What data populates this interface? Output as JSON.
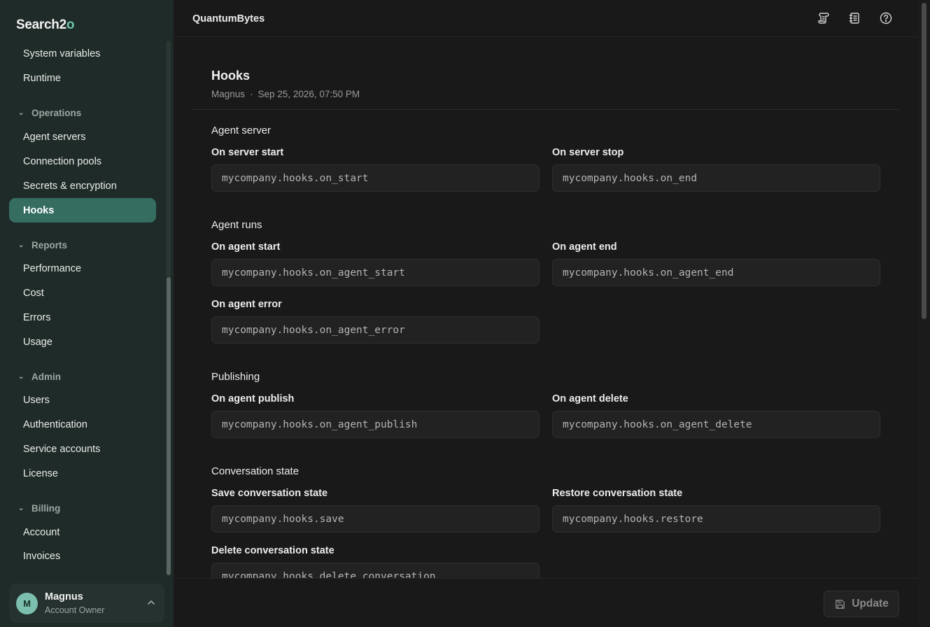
{
  "app": {
    "logo_main": "Search2",
    "logo_accent": "o",
    "org_name": "QuantumBytes"
  },
  "sidebar": {
    "items_top": [
      "System variables",
      "Runtime"
    ],
    "sections": [
      {
        "title": "Operations",
        "items": [
          "Agent servers",
          "Connection pools",
          "Secrets & encryption",
          "Hooks"
        ]
      },
      {
        "title": "Reports",
        "items": [
          "Performance",
          "Cost",
          "Errors",
          "Usage"
        ]
      },
      {
        "title": "Admin",
        "items": [
          "Users",
          "Authentication",
          "Service accounts",
          "License"
        ]
      },
      {
        "title": "Billing",
        "items": [
          "Account",
          "Invoices"
        ]
      }
    ],
    "active_item": "Hooks",
    "user": {
      "initial": "M",
      "name": "Magnus",
      "role": "Account Owner"
    }
  },
  "header": {
    "icons": [
      "scroll-icon",
      "notebook-icon",
      "help-icon"
    ]
  },
  "page": {
    "title": "Hooks",
    "author": "Magnus",
    "separator": "·",
    "timestamp": "Sep 25, 2026, 07:50 PM",
    "groups": [
      {
        "title": "Agent server",
        "fields": [
          {
            "label": "On server start",
            "value": "mycompany.hooks.on_start"
          },
          {
            "label": "On server stop",
            "value": "mycompany.hooks.on_end"
          }
        ]
      },
      {
        "title": "Agent runs",
        "fields": [
          {
            "label": "On agent start",
            "value": "mycompany.hooks.on_agent_start"
          },
          {
            "label": "On agent end",
            "value": "mycompany.hooks.on_agent_end"
          },
          {
            "label": "On agent error",
            "value": "mycompany.hooks.on_agent_error"
          }
        ]
      },
      {
        "title": "Publishing",
        "fields": [
          {
            "label": "On agent publish",
            "value": "mycompany.hooks.on_agent_publish"
          },
          {
            "label": "On agent delete",
            "value": "mycompany.hooks.on_agent_delete"
          }
        ]
      },
      {
        "title": "Conversation state",
        "fields": [
          {
            "label": "Save conversation state",
            "value": "mycompany.hooks.save"
          },
          {
            "label": "Restore conversation state",
            "value": "mycompany.hooks.restore"
          },
          {
            "label": "Delete conversation state",
            "value": "mycompany.hooks.delete_conversation"
          }
        ]
      }
    ]
  },
  "footer": {
    "update_label": "Update"
  },
  "colors": {
    "accent": "#6cc3b0",
    "active_nav": "#356d61",
    "sidebar_bg": "#1f2b28",
    "main_bg": "#191919"
  }
}
